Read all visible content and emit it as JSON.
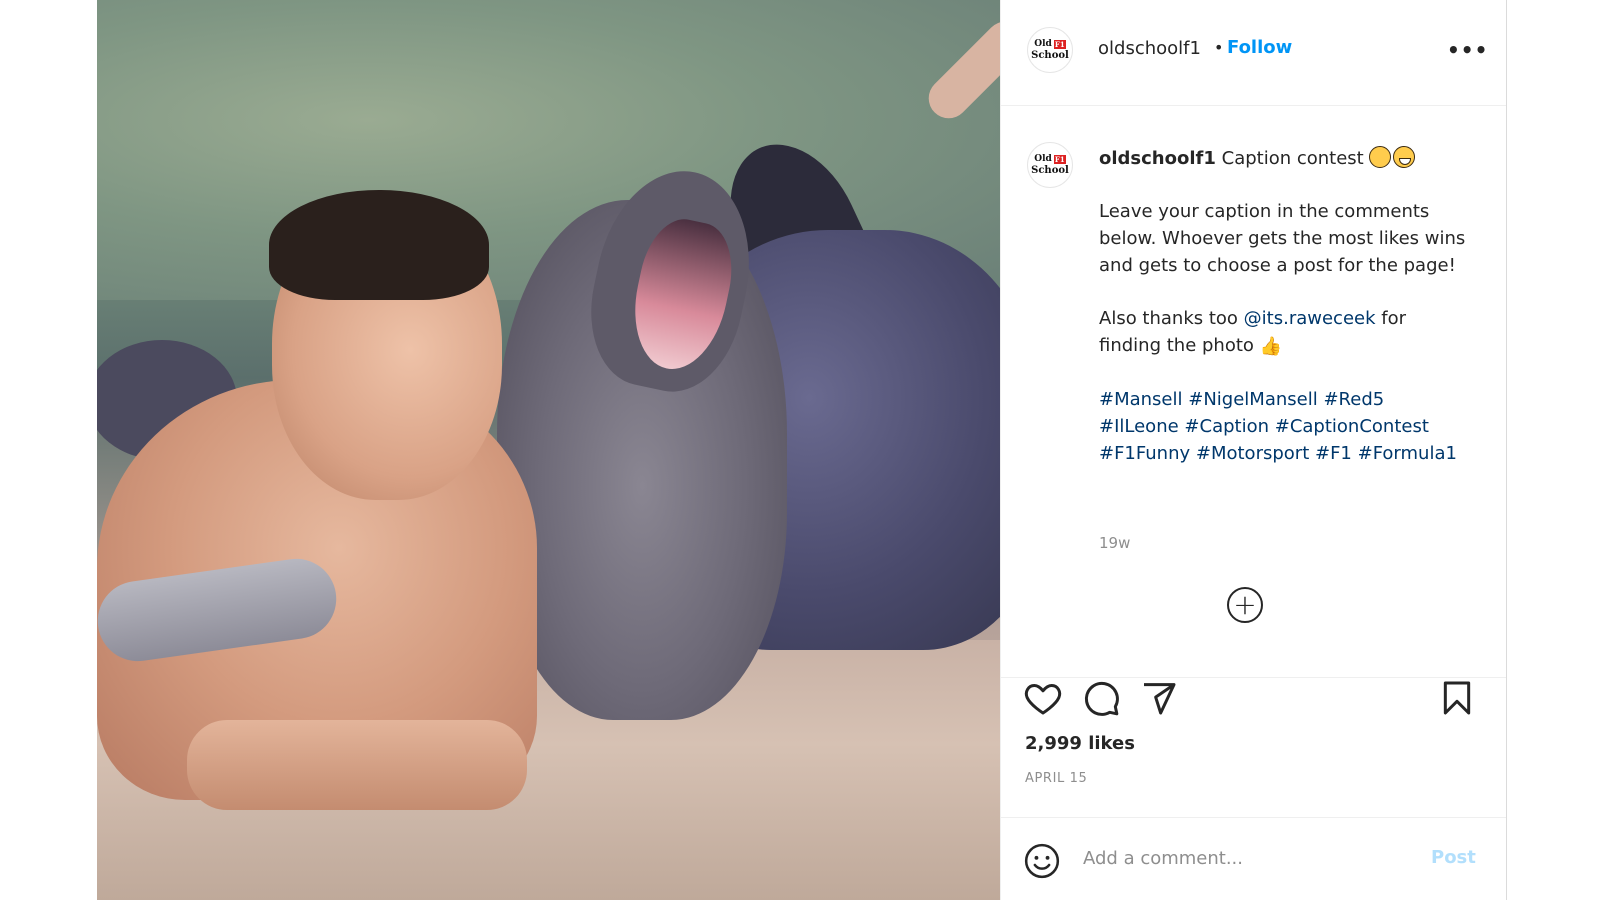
{
  "post": {
    "image": {
      "icon": "photo-man-with-dolphins"
    },
    "header": {
      "username": "oldschoolf1",
      "separator": "•",
      "follow_label": "Follow",
      "more_label": "•••"
    },
    "avatar": {
      "top_text": "Old",
      "badge_text": "F1",
      "bottom_text": "School"
    },
    "caption": {
      "username": "oldschoolf1",
      "title": "Caption contest",
      "paragraph1": "Leave your caption in the comments below. Whoever gets the most likes wins and gets to choose a post for the page!",
      "thanks_prefix": "Also thanks too",
      "mention": "@its.raweceek",
      "thanks_suffix": "for finding the photo",
      "hashtags": [
        "#Mansell",
        "#NigelMansell",
        "#Red5",
        "#IlLeone",
        "#Caption",
        "#CaptionContest",
        "#F1Funny",
        "#Motorsport",
        "#F1",
        "#Formula1"
      ],
      "time_ago": "19w"
    },
    "load_more_label": "+",
    "actions": {
      "like_icon": "heart-icon",
      "comment_icon": "comment-bubble-icon",
      "share_icon": "paper-plane-icon",
      "save_icon": "bookmark-icon"
    },
    "likes": "2,999 likes",
    "date": "APRIL 15",
    "comment": {
      "placeholder": "Add a comment...",
      "post_label": "Post",
      "emoji_icon": "smiley-icon"
    }
  },
  "colors": {
    "accent": "#0095f6",
    "link": "#00376b",
    "muted": "#8e8e8e",
    "post_disabled": "#b2dffc"
  }
}
